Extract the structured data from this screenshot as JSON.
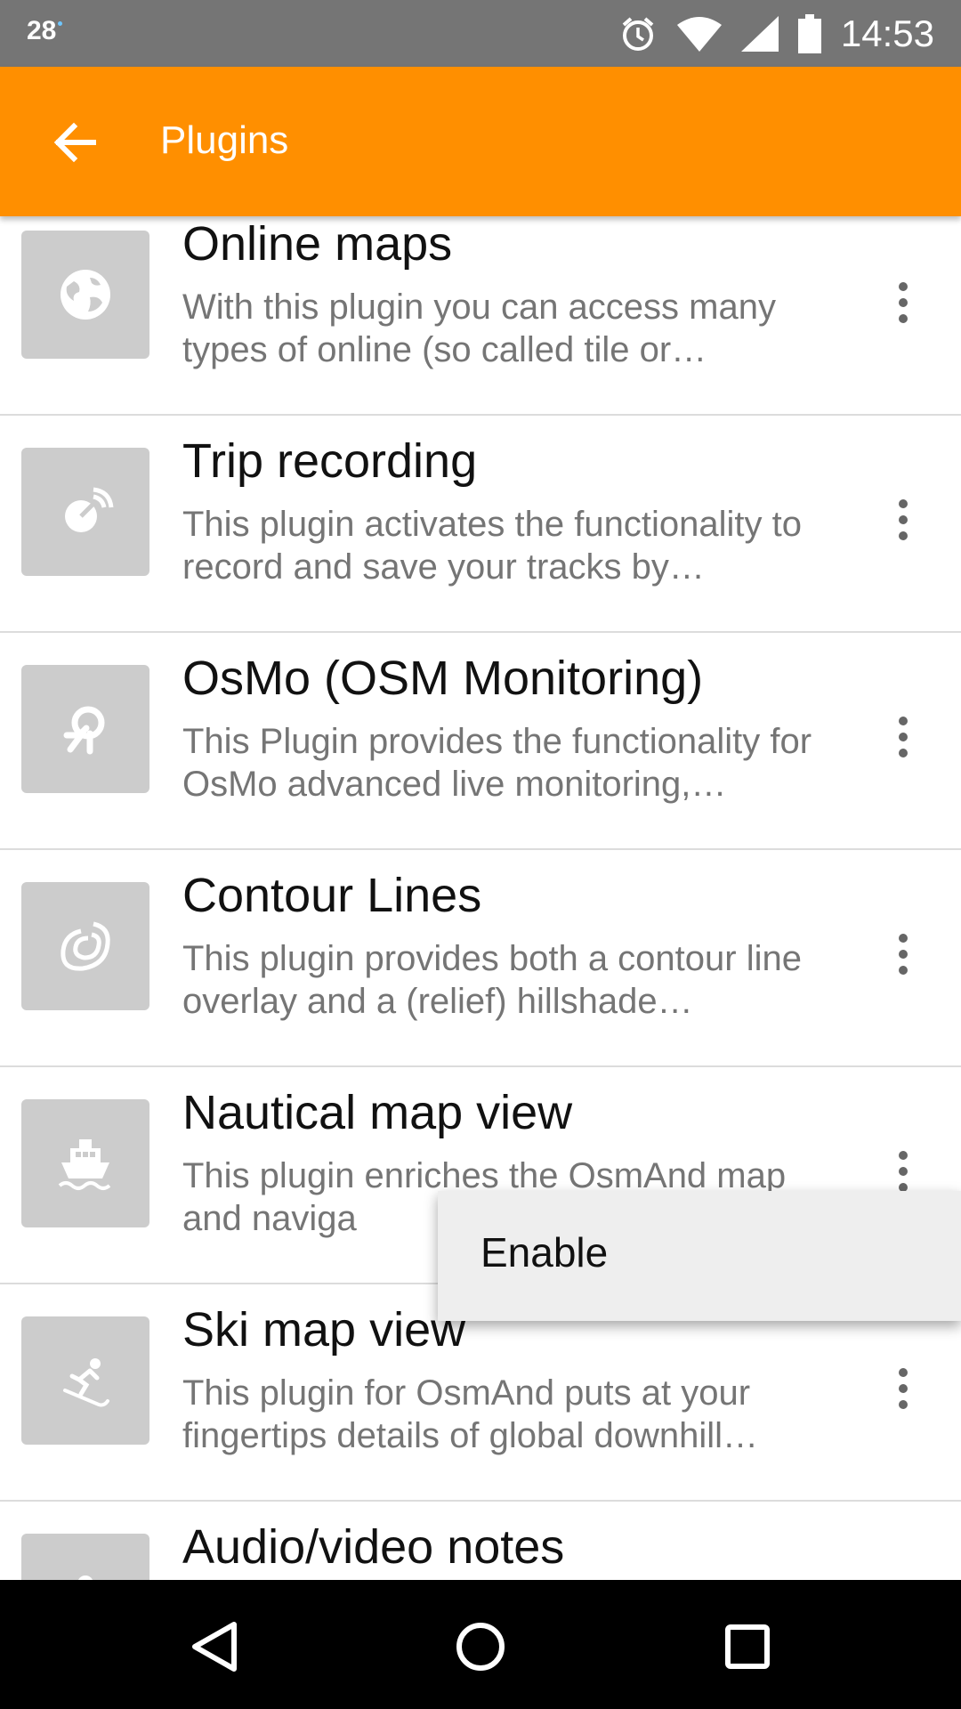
{
  "status_bar": {
    "left_text": "28",
    "time": "14:53",
    "icons": [
      "alarm-icon",
      "wifi-icon",
      "signal-icon",
      "battery-icon"
    ]
  },
  "app_bar": {
    "title": "Plugins",
    "back_icon": "arrow-back-icon",
    "color": "#ff8f00"
  },
  "plugins": [
    {
      "title": "Online maps",
      "description": "With this plugin you can access many types of online (so called tile or…",
      "icon": "globe-icon"
    },
    {
      "title": "Trip recording",
      "description": "This plugin activates the functionality to record and save your tracks by…",
      "icon": "satellite-icon"
    },
    {
      "title": "OsMo (OSM Monitoring)",
      "description": "This Plugin provides the functionality for OsMo advanced live monitoring,…",
      "icon": "monitoring-icon"
    },
    {
      "title": "Contour Lines",
      "description": "This plugin provides both a contour line overlay and a (relief) hillshade…",
      "icon": "contour-icon"
    },
    {
      "title": "Nautical map view",
      "description": "This plugin enriches the OsmAnd map and naviga",
      "icon": "ship-icon"
    },
    {
      "title": "Ski map view",
      "description": "This plugin for OsmAnd puts at your fingertips details of global downhill…",
      "icon": "skier-icon"
    },
    {
      "title": "Audio/video notes",
      "description": "",
      "icon": "audio-video-icon"
    }
  ],
  "popup_menu": {
    "items": [
      "Enable"
    ]
  },
  "nav_bar": {
    "icons": [
      "back-triangle-icon",
      "home-circle-icon",
      "recents-square-icon"
    ]
  }
}
